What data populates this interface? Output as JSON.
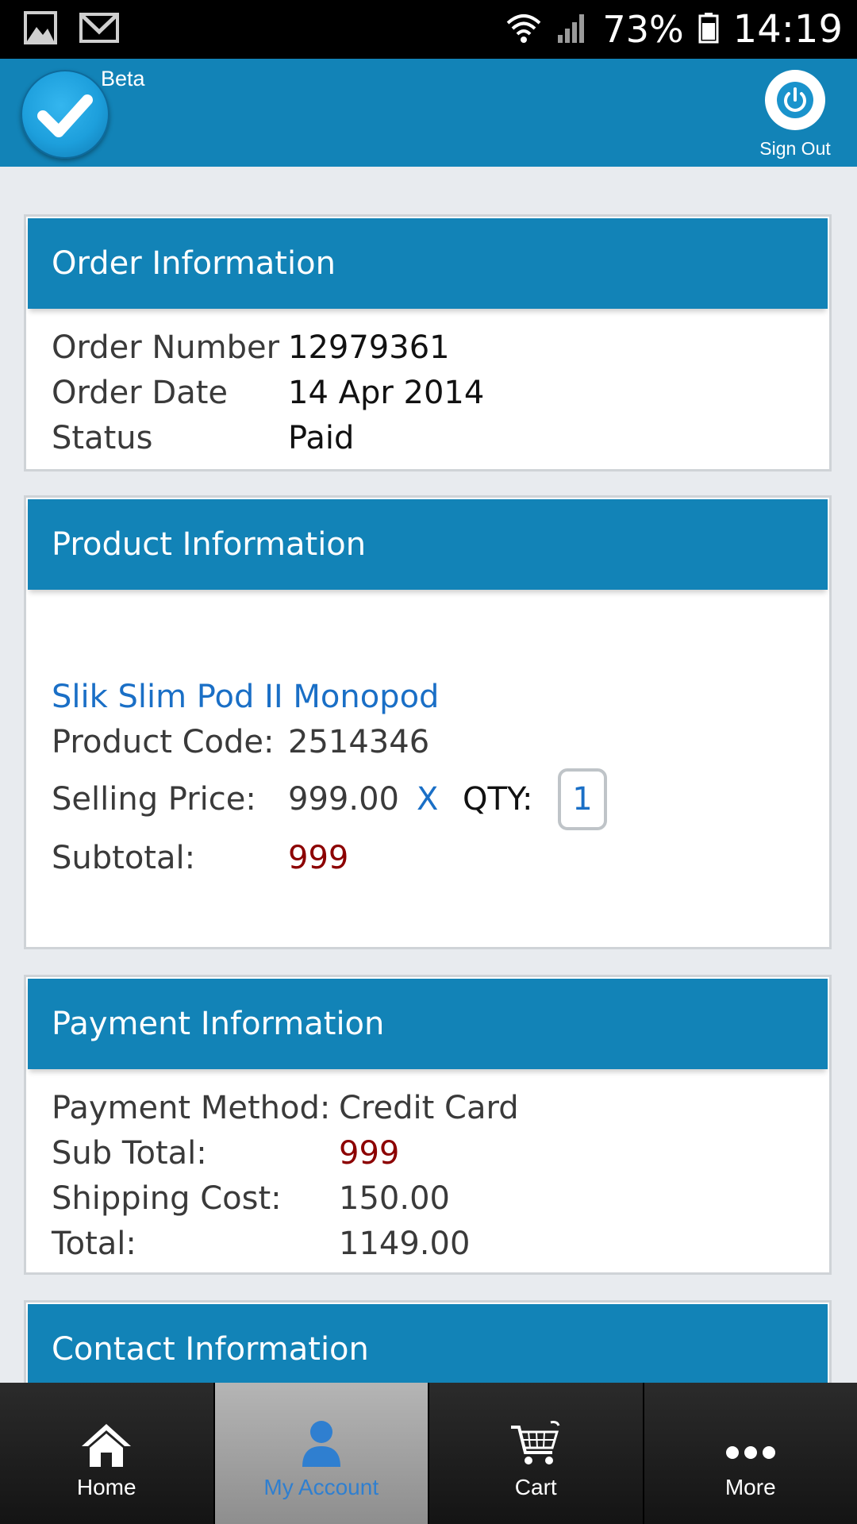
{
  "status_bar": {
    "battery_percent": "73%",
    "time": "14:19",
    "icons": [
      "gallery-icon",
      "gmail-icon",
      "wifi-icon",
      "signal-icon",
      "battery-icon"
    ]
  },
  "app_bar": {
    "beta_label": "Beta",
    "sign_out_label": "Sign Out",
    "accent_color": "#1283b7"
  },
  "order": {
    "title": "Order Information",
    "rows": [
      {
        "label": "Order Number",
        "value": "12979361"
      },
      {
        "label": "Order Date",
        "value": "14 Apr 2014"
      },
      {
        "label": "Status",
        "value": "Paid"
      }
    ]
  },
  "product": {
    "title": "Product Information",
    "name": "Slik Slim Pod II Monopod",
    "code_label": "Product Code:",
    "code_value": "2514346",
    "price_label": "Selling Price:",
    "price_value": "999.00",
    "times_symbol": "X",
    "qty_label": "QTY:",
    "qty_value": "1",
    "subtotal_label": "Subtotal:",
    "subtotal_value": "999"
  },
  "payment": {
    "title": "Payment Information",
    "rows": [
      {
        "label": "Payment Method:",
        "value": "Credit Card"
      },
      {
        "label": "Sub Total:",
        "value": "999"
      },
      {
        "label": "Shipping Cost:",
        "value": "150.00"
      },
      {
        "label": "Total:",
        "value": "1149.00"
      }
    ]
  },
  "contact": {
    "title": "Contact Information"
  },
  "nav": {
    "items": [
      {
        "label": "Home",
        "icon": "home-icon"
      },
      {
        "label": "My Account",
        "icon": "user-icon",
        "active": true
      },
      {
        "label": "Cart",
        "icon": "cart-icon"
      },
      {
        "label": "More",
        "icon": "more-icon"
      }
    ]
  }
}
